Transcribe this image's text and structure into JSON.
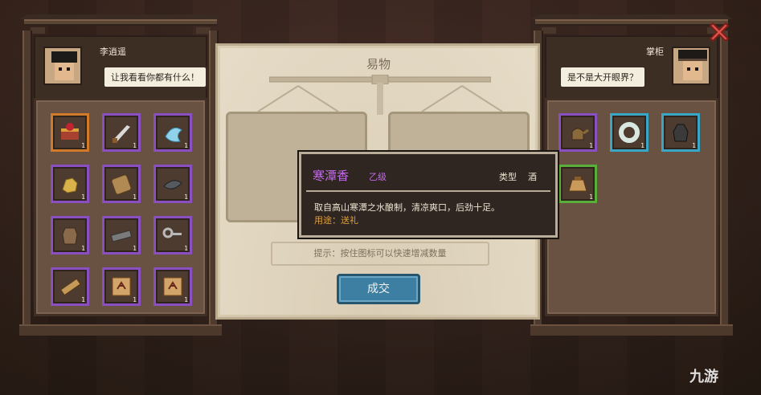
{
  "left_panel": {
    "npc_name": "李逍遥",
    "speech": "让我看看你都有什么！",
    "items": [
      {
        "icon": "treasure-box-icon",
        "qty": "1",
        "rarity": "orange"
      },
      {
        "icon": "blade-icon",
        "qty": "1",
        "rarity": "purple"
      },
      {
        "icon": "ice-crystal-icon",
        "qty": "1",
        "rarity": "purple"
      },
      {
        "icon": "gold-nugget-icon",
        "qty": "1",
        "rarity": "purple"
      },
      {
        "icon": "wooden-plaque-icon",
        "qty": "1",
        "rarity": "purple"
      },
      {
        "icon": "whetstone-icon",
        "qty": "1",
        "rarity": "purple"
      },
      {
        "icon": "clay-jar-icon",
        "qty": "1",
        "rarity": "purple"
      },
      {
        "icon": "iron-bar-icon",
        "qty": "1",
        "rarity": "purple"
      },
      {
        "icon": "key-icon",
        "qty": "1",
        "rarity": "purple"
      },
      {
        "icon": "scroll-icon",
        "qty": "1",
        "rarity": "purple"
      },
      {
        "icon": "map-icon",
        "qty": "1",
        "rarity": "purple"
      },
      {
        "icon": "map-icon",
        "qty": "1",
        "rarity": "purple"
      }
    ]
  },
  "right_panel": {
    "npc_name": "掌柜",
    "speech": "是不是大开眼界？",
    "items": [
      {
        "icon": "teapot-icon",
        "qty": "1",
        "rarity": "purple"
      },
      {
        "icon": "jade-ring-icon",
        "qty": "1",
        "rarity": "cyan"
      },
      {
        "icon": "wine-jar-icon",
        "qty": "1",
        "rarity": "cyan"
      },
      {
        "icon": "pouch-icon",
        "qty": "1",
        "rarity": "green"
      }
    ]
  },
  "center": {
    "title": "易物",
    "hint": "提示：按住图标可以快速增减数量",
    "confirm_label": "成交"
  },
  "tooltip": {
    "item_name": "寒潭香",
    "grade": "乙级",
    "type_label": "类型",
    "type_value": "酒",
    "description": "取自高山寒潭之水酿制，清凉爽口，后劲十足。",
    "usage": "用途：送礼"
  },
  "watermark": "九游",
  "colors": {
    "purple": "#8a4fc1",
    "orange": "#d07a2a",
    "cyan": "#3aa6c6",
    "green": "#5aae3a",
    "tooltip_name": "#c16ce6",
    "usage_text": "#e0a140",
    "confirm_button": "#3d7fa3"
  }
}
